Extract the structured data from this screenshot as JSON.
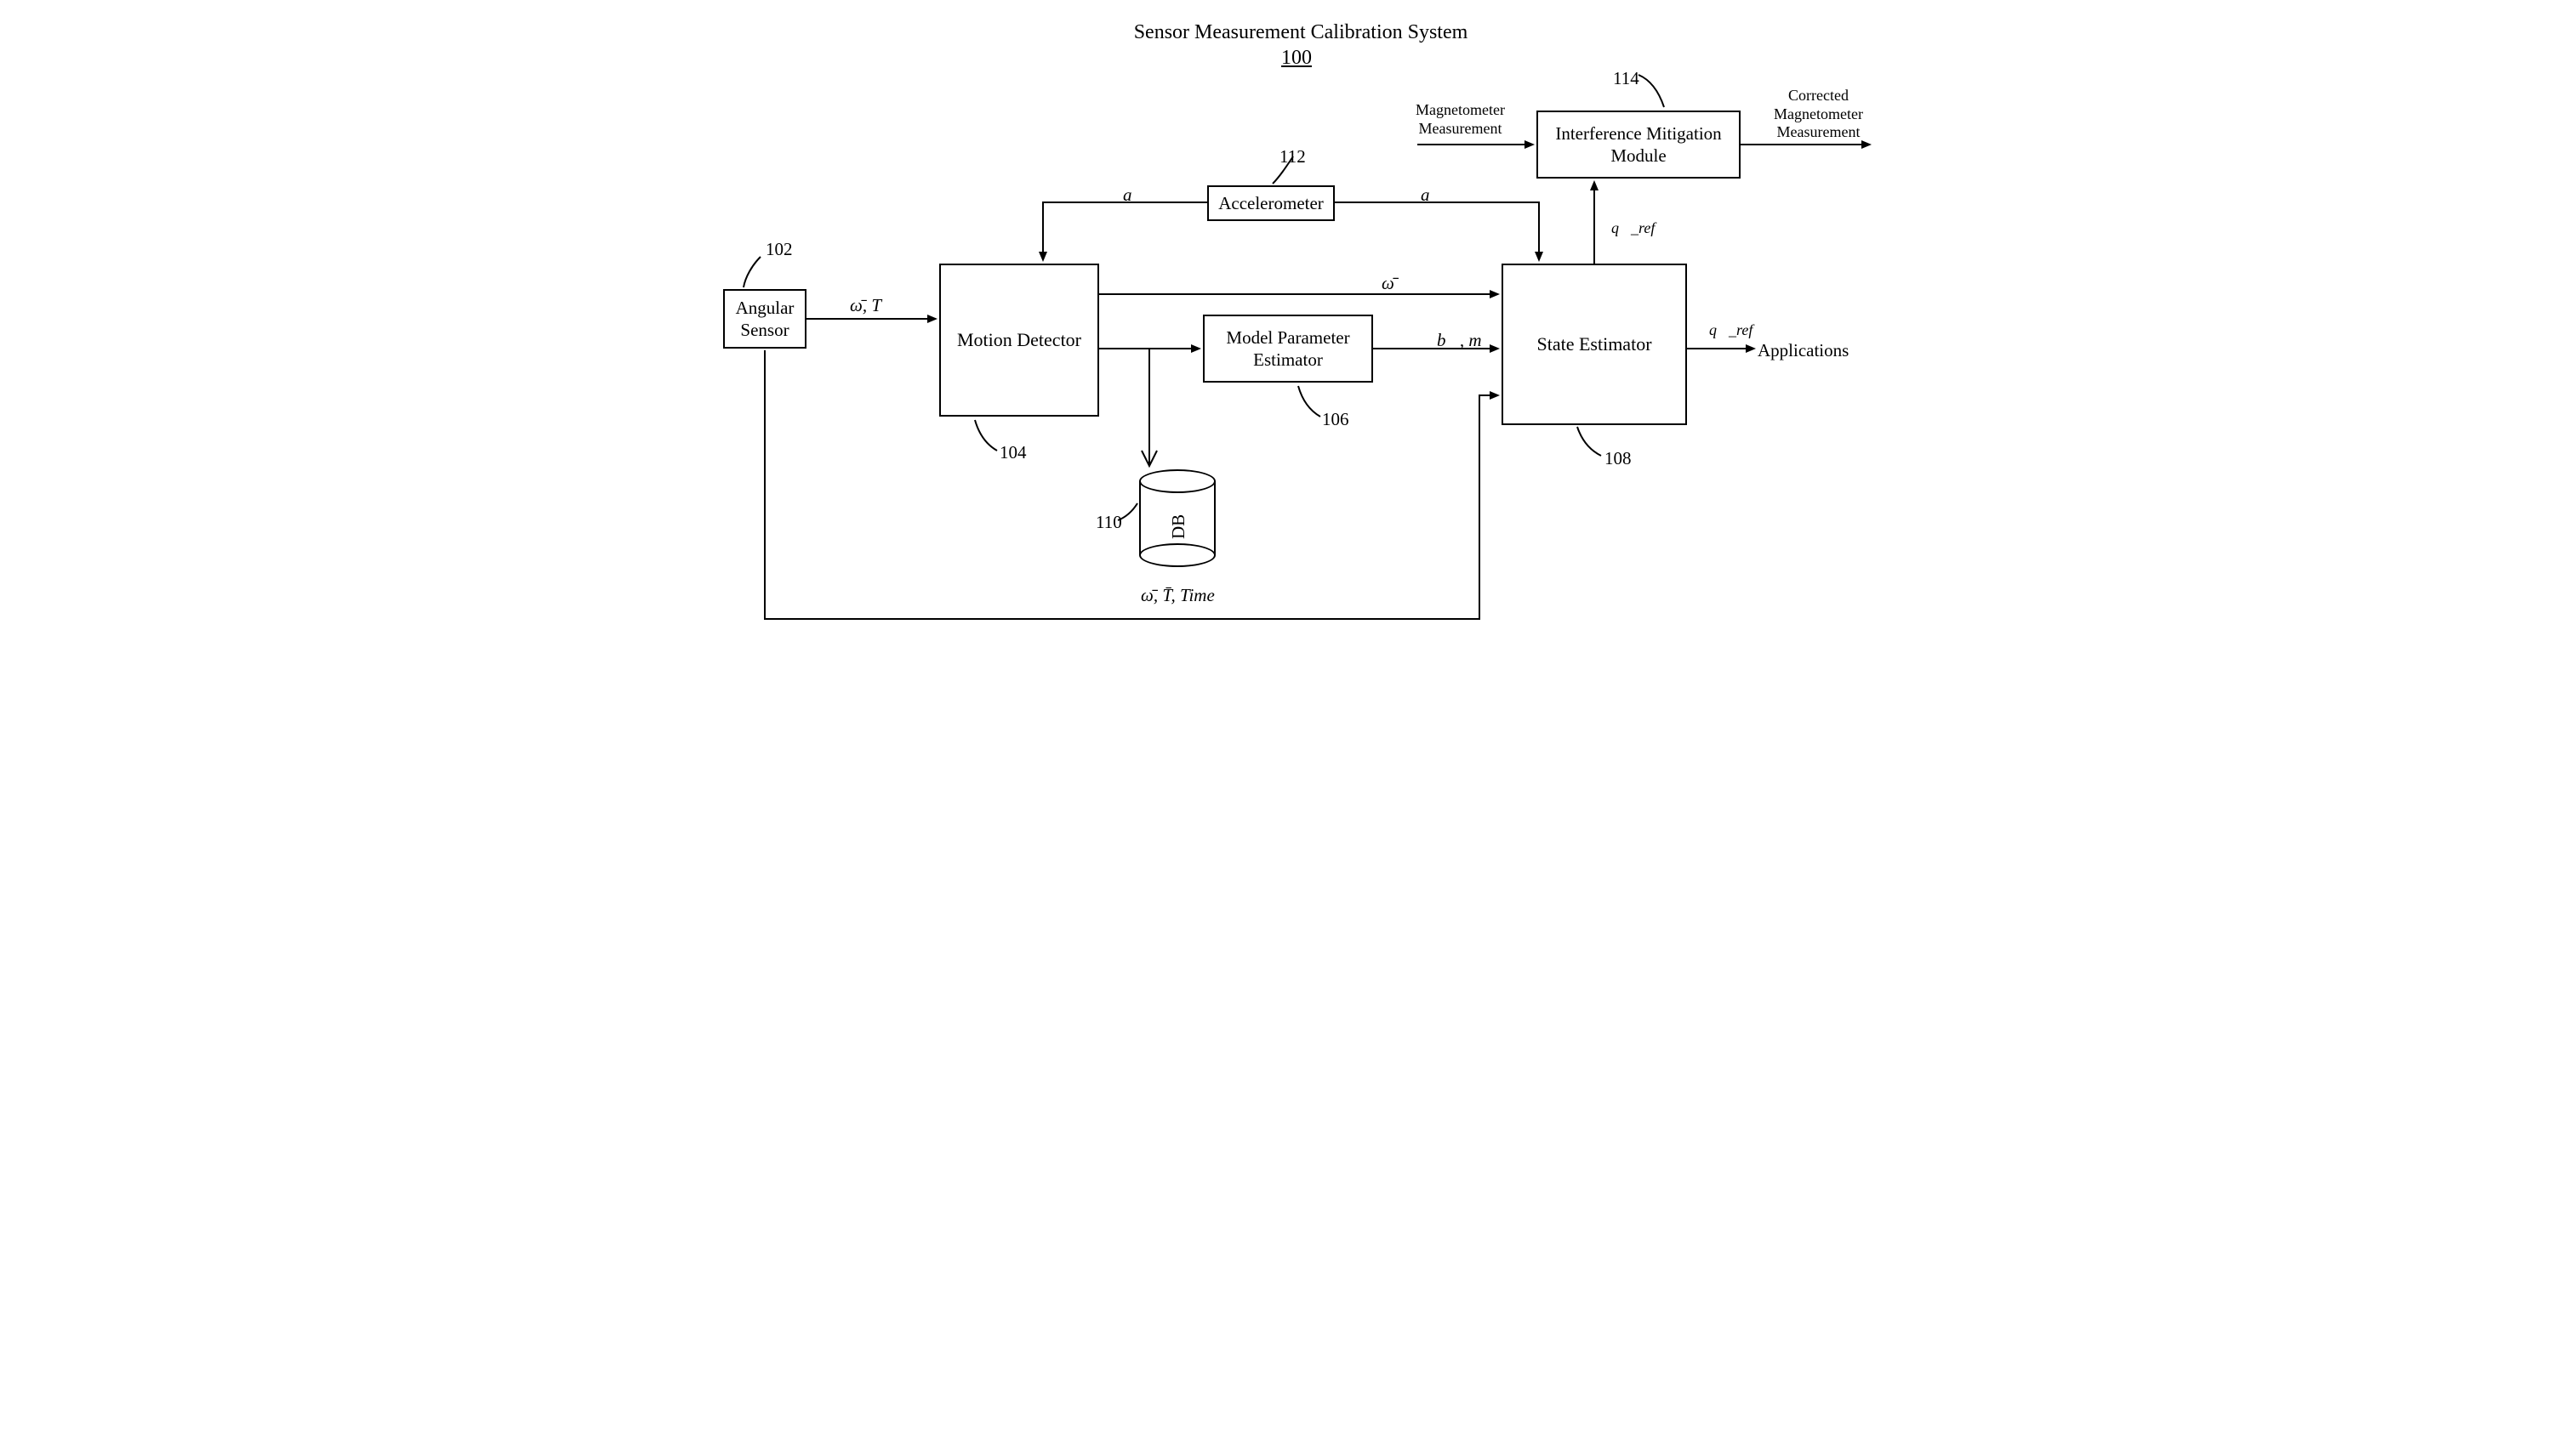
{
  "title": "Sensor Measurement Calibration System",
  "title_ref": "100",
  "refs": {
    "angular": "102",
    "motion": "104",
    "model": "106",
    "state": "108",
    "db": "110",
    "accel": "112",
    "interf": "114"
  },
  "blocks": {
    "angular": "Angular\nSensor",
    "motion": "Motion Detector",
    "model": "Model Parameter\nEstimator",
    "state": "State Estimator",
    "accel": "Accelerometer",
    "interf": "Interference Mitigation\nModule",
    "db": "DB"
  },
  "signals": {
    "omega_T": "ω̄, T",
    "a_vec1": "a⃗",
    "a_vec2": "a⃗",
    "omega_mean": "ω̄̄",
    "b_m": "b⃗, m⃗",
    "q_ref_up": "q⃗_ref",
    "q_ref_out": "q⃗_ref",
    "db_caption": "ω̄̄, T̄, Time",
    "mag_in": "Magnetometer\nMeasurement",
    "mag_out": "Corrected\nMagnetometer\nMeasurement",
    "apps": "Applications"
  }
}
